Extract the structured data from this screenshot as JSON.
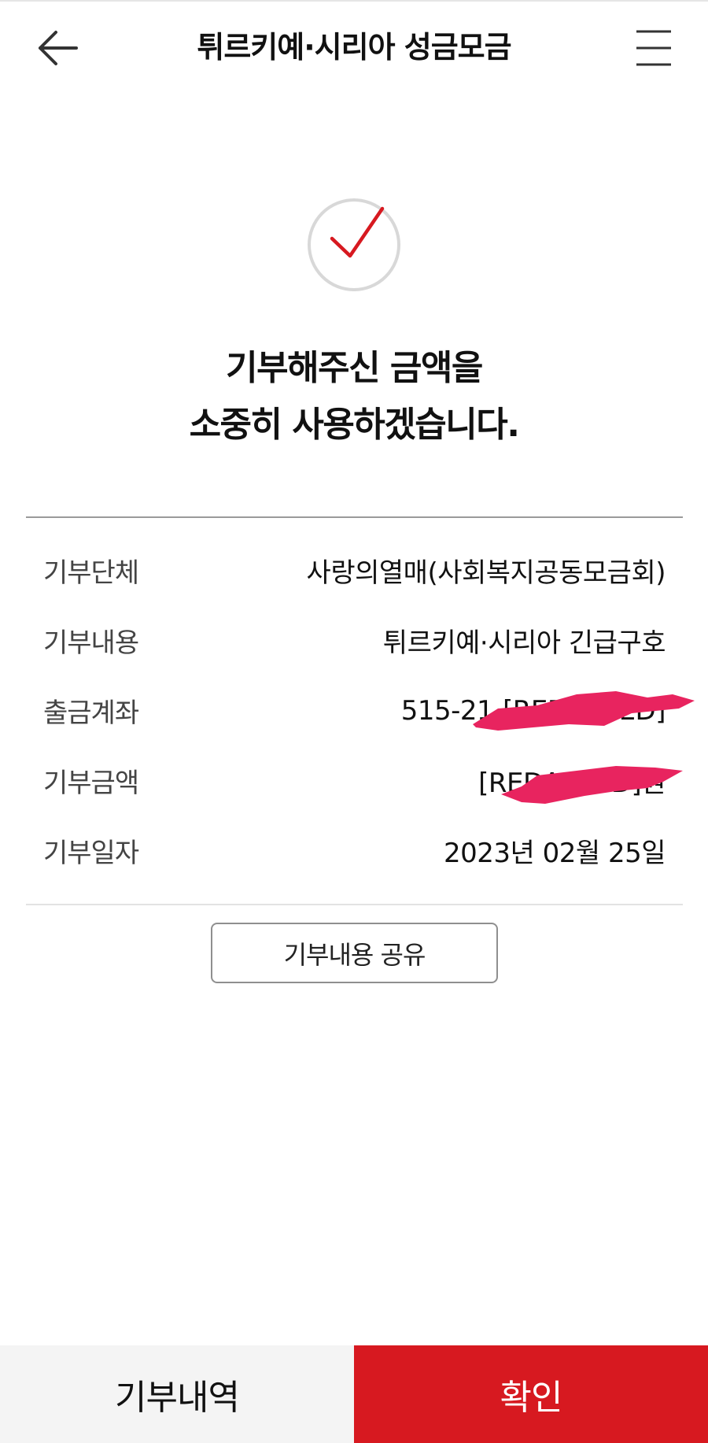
{
  "header": {
    "title": "튀르키예·시리아 성금모금",
    "back_icon": "arrow-left-icon",
    "menu_icon": "hamburger-menu-icon"
  },
  "status": {
    "icon": "check-circle-icon",
    "message_line1": "기부해주신 금액을",
    "message_line2": "소중히 사용하겠습니다."
  },
  "details": [
    {
      "label": "기부단체",
      "value": "사랑의열매(사회복지공동모금회)"
    },
    {
      "label": "기부내용",
      "value": "튀르키예·시리아 긴급구호"
    },
    {
      "label": "출금계좌",
      "value": "515-21-[REDACTED]",
      "redacted": true
    },
    {
      "label": "기부금액",
      "value": "[REDACTED]원",
      "redacted": true
    },
    {
      "label": "기부일자",
      "value": "2023년 02월 25일"
    }
  ],
  "share_button": {
    "label": "기부내용 공유"
  },
  "bottom_bar": {
    "history_label": "기부내역",
    "confirm_label": "확인"
  },
  "colors": {
    "accent": "#d71920",
    "redaction": "#e8245f",
    "history_bg": "#f4f4f4"
  }
}
